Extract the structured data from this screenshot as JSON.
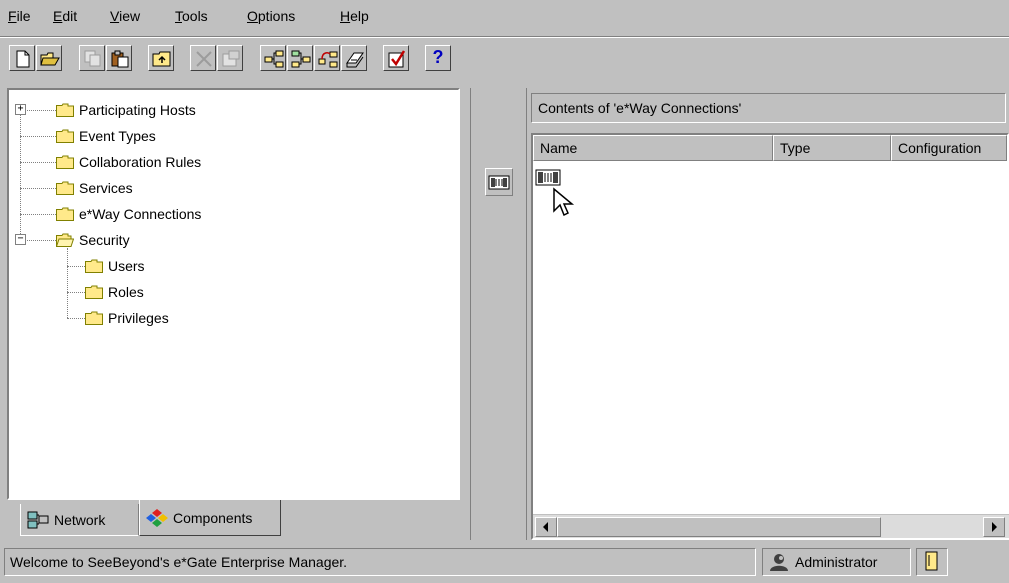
{
  "menu": {
    "items": [
      {
        "pre": "",
        "u": "F",
        "post": "ile"
      },
      {
        "pre": "",
        "u": "E",
        "post": "dit"
      },
      {
        "pre": "",
        "u": "V",
        "post": "iew"
      },
      {
        "pre": "",
        "u": "T",
        "post": "ools"
      },
      {
        "pre": "",
        "u": "O",
        "post": "ptions"
      },
      {
        "pre": "",
        "u": "H",
        "post": "elp"
      }
    ]
  },
  "toolbar": {
    "buttons": [
      {
        "icon": "new-document-icon"
      },
      {
        "icon": "open-folder-icon"
      },
      {
        "icon": "copy-icon",
        "disabled": true
      },
      {
        "icon": "paste-icon"
      },
      {
        "icon": "up-one-level-icon"
      },
      {
        "icon": "delete-icon",
        "disabled": true
      },
      {
        "icon": "properties-icon",
        "disabled": true
      },
      {
        "icon": "new-component-icon"
      },
      {
        "icon": "new-child-component-icon"
      },
      {
        "icon": "collaboration-icon"
      },
      {
        "icon": "edit-icon"
      },
      {
        "icon": "check-icon"
      },
      {
        "icon": "help-icon",
        "label": "?"
      }
    ]
  },
  "tree": {
    "items": [
      {
        "label": "Participating Hosts",
        "expander": "+"
      },
      {
        "label": "Event Types"
      },
      {
        "label": "Collaboration Rules"
      },
      {
        "label": "Services"
      },
      {
        "label": "e*Way Connections"
      },
      {
        "label": "Security",
        "expander": "−"
      },
      {
        "label": "Users"
      },
      {
        "label": "Roles"
      },
      {
        "label": "Privileges"
      }
    ]
  },
  "tabs": {
    "network": "Network",
    "components": "Components"
  },
  "contents": {
    "header": "Contents of  'e*Way Connections'",
    "columns": [
      "Name",
      "Type",
      "Configuration"
    ]
  },
  "status": {
    "message": "Welcome to SeeBeyond's e*Gate Enterprise Manager.",
    "user": "Administrator"
  },
  "colors": {
    "face": "#c0c0c0",
    "folder": "#ffe98a"
  }
}
